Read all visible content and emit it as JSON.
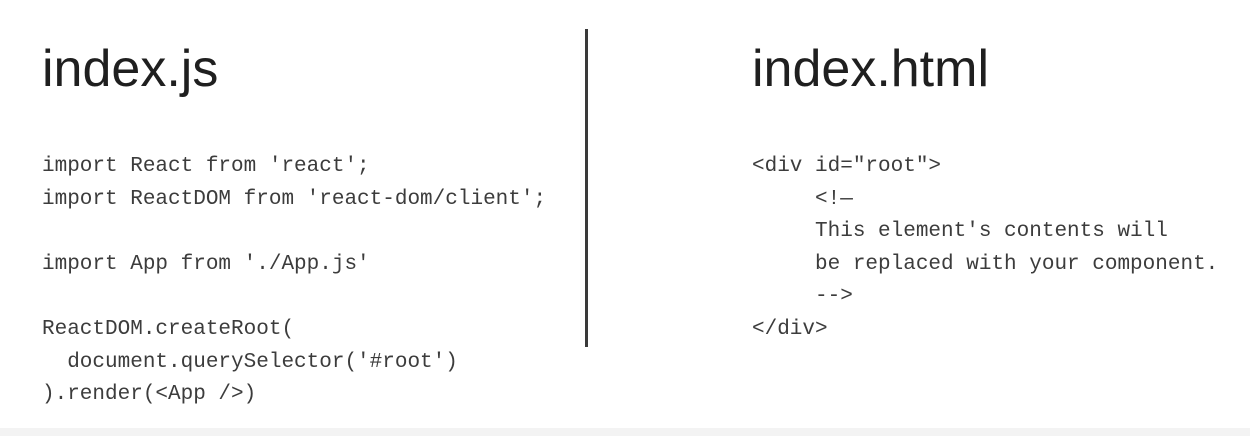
{
  "left_panel": {
    "title": "index.js",
    "code_lines": [
      "import React from 'react';",
      "import ReactDOM from 'react-dom/client';",
      "",
      "import App from './App.js'",
      "",
      "ReactDOM.createRoot(",
      "  document.querySelector('#root')",
      ").render(<App />)"
    ]
  },
  "right_panel": {
    "title": "index.html",
    "code_lines": [
      "<div id=\"root\">",
      "     <!—",
      "     This element's contents will",
      "     be replaced with your component.",
      "     -->",
      "</div>"
    ]
  }
}
